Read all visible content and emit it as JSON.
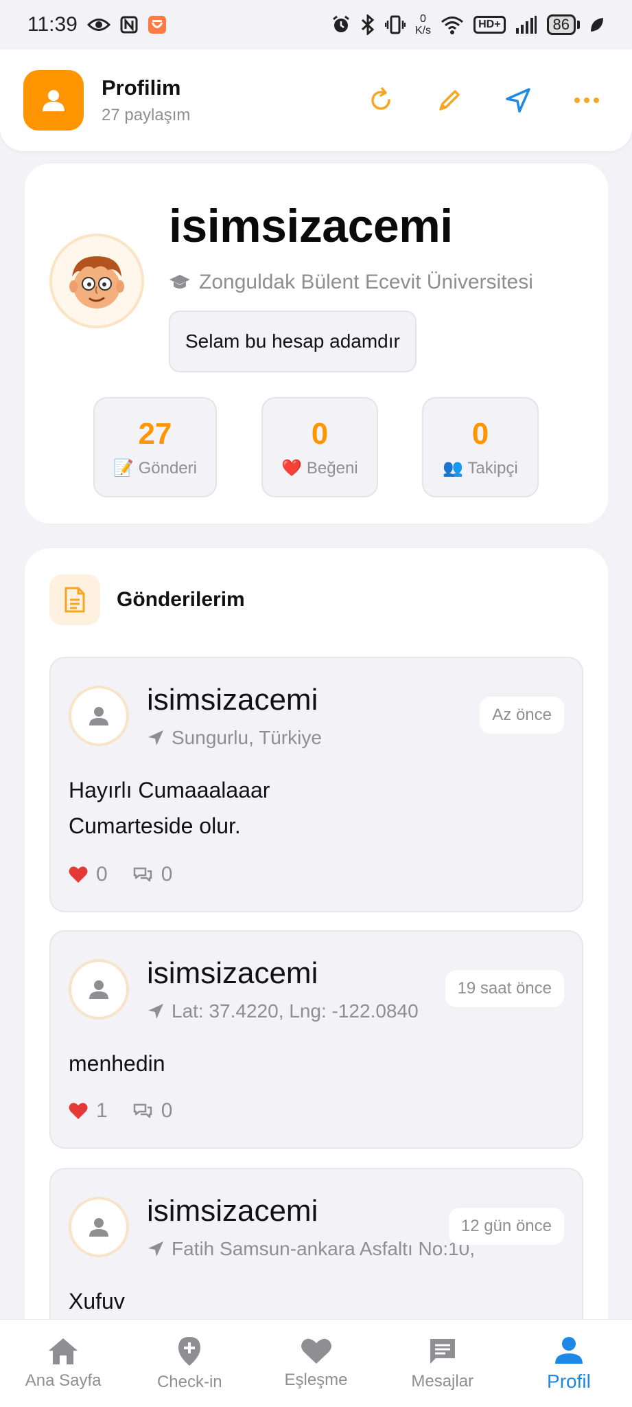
{
  "status_bar": {
    "time": "11:39",
    "net_speed_value": "0",
    "net_speed_unit": "K/s",
    "hd_label": "HD+",
    "battery": "86"
  },
  "header": {
    "title": "Profilim",
    "subtitle": "27 paylaşım",
    "accent_color": "#FF9500"
  },
  "profile": {
    "username": "isimsizacemi",
    "school": "Zonguldak Bülent Ecevit Üniversitesi",
    "bio": "Selam bu hesap adamdır",
    "stats": [
      {
        "value": "27",
        "label": "📝 Gönderi"
      },
      {
        "value": "0",
        "label": "❤️ Beğeni"
      },
      {
        "value": "0",
        "label": "👥 Takipçi"
      }
    ]
  },
  "posts_section": {
    "title": "Gönderilerim"
  },
  "posts": [
    {
      "user": "isimsizacemi",
      "location": "Sungurlu, Türkiye",
      "time": "Az önce",
      "text_lines": [
        "Hayırlı Cumaaalaaar",
        "Cumarteside olur."
      ],
      "likes": "0",
      "comments": "0"
    },
    {
      "user": "isimsizacemi",
      "location": "Lat: 37.4220, Lng: -122.0840",
      "time": "19 saat önce",
      "text_lines": [
        "menhedin"
      ],
      "likes": "1",
      "comments": "0"
    },
    {
      "user": "isimsizacemi",
      "location": "Fatih Samsun-ankara Asfaltı No:10,",
      "time": "12 gün önce",
      "text_lines": [
        "Xufuv"
      ]
    }
  ],
  "nav": {
    "items": [
      {
        "label": "Ana Sayfa",
        "icon": "home-icon"
      },
      {
        "label": "Check-in",
        "icon": "location-plus-icon"
      },
      {
        "label": "Eşleşme",
        "icon": "heart-icon"
      },
      {
        "label": "Mesajlar",
        "icon": "message-icon"
      },
      {
        "label": "Profil",
        "icon": "person-icon",
        "active": true
      }
    ],
    "active_color": "#1E88E5"
  }
}
